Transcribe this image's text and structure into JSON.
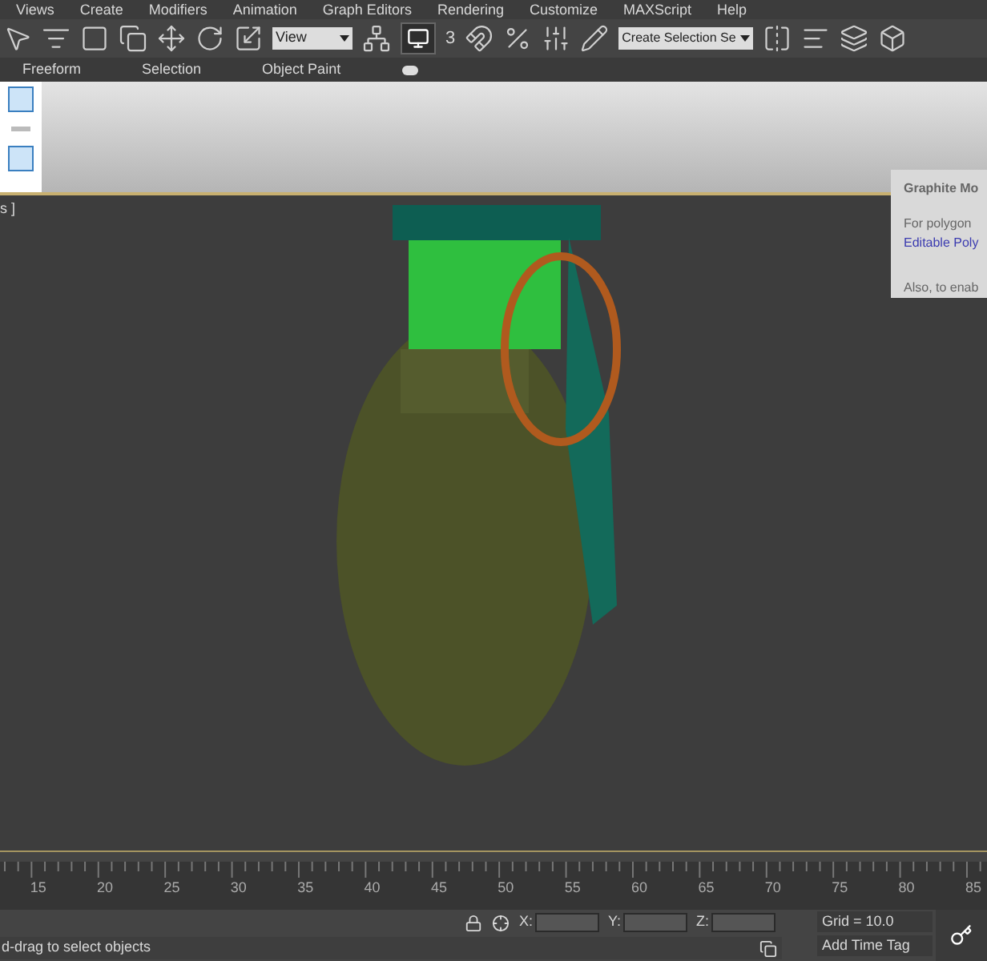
{
  "menu_bar": [
    "Views",
    "Create",
    "Modifiers",
    "Animation",
    "Graph Editors",
    "Rendering",
    "Customize",
    "MAXScript",
    "Help"
  ],
  "toolbar": {
    "view_dropdown": "View",
    "snap_count": "3",
    "selection_set_dropdown": "Create Selection Se"
  },
  "ribbon_tabs": [
    "Freeform",
    "Selection",
    "Object Paint"
  ],
  "viewport": {
    "label": "s ]"
  },
  "tooltip": {
    "title": "Graphite Mo",
    "lines": [
      {
        "text": "For polygon",
        "kind": "text"
      },
      {
        "text": "Editable Poly",
        "kind": "link"
      },
      {
        "text": "Also, to enab",
        "kind": "text"
      }
    ]
  },
  "timeline": {
    "ticks": [
      "15",
      "20",
      "25",
      "30",
      "35",
      "40",
      "45",
      "50",
      "55",
      "60",
      "65",
      "70",
      "75",
      "80",
      "85"
    ]
  },
  "status": {
    "prompt": "d-drag to select objects",
    "x_label": "X:",
    "y_label": "Y:",
    "z_label": "Z:",
    "grid": "Grid = 10.0",
    "time_tag": "Add Time Tag"
  }
}
